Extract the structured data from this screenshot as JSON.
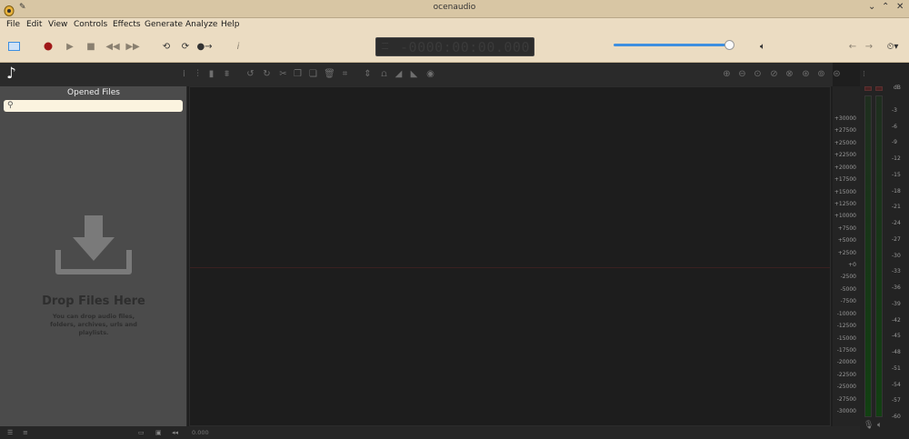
{
  "window": {
    "title": "ocenaudio"
  },
  "menu": [
    "File",
    "Edit",
    "View",
    "Controls",
    "Effects",
    "Generate",
    "Analyze",
    "Help"
  ],
  "transport": {
    "lcd_time": "-0000:00:00.000",
    "lcd_small_top": "----",
    "lcd_small_bottom": "----"
  },
  "volume": {
    "level": 0.95
  },
  "sidebar": {
    "title": "Opened Files",
    "search_placeholder": "",
    "drop_title": "Drop Files Here",
    "drop_subtitle": "You can drop audio files, folders, archives, urls and playlists."
  },
  "scale": {
    "labels": [
      "+30000",
      "+27500",
      "+25000",
      "+22500",
      "+20000",
      "+17500",
      "+15000",
      "+12500",
      "+10000",
      "+7500",
      "+5000",
      "+2500",
      "+0",
      "-2500",
      "-5000",
      "-7500",
      "-10000",
      "-12500",
      "-15000",
      "-17500",
      "-20000",
      "-22500",
      "-25000",
      "-27500",
      "-30000"
    ]
  },
  "meters": {
    "unit": "dB",
    "labels": [
      "-3",
      "-6",
      "-9",
      "-12",
      "-15",
      "-18",
      "-21",
      "-24",
      "-27",
      "-30",
      "-33",
      "-36",
      "-39",
      "-42",
      "-45",
      "-48",
      "-51",
      "-54",
      "-57",
      "-60"
    ]
  },
  "status": {
    "time": "0.000"
  },
  "colors": {
    "accent": "#3d8fe0",
    "titlebar": "#d8c6a4",
    "toolbar": "#ebdcc2",
    "record": "#a01818"
  }
}
